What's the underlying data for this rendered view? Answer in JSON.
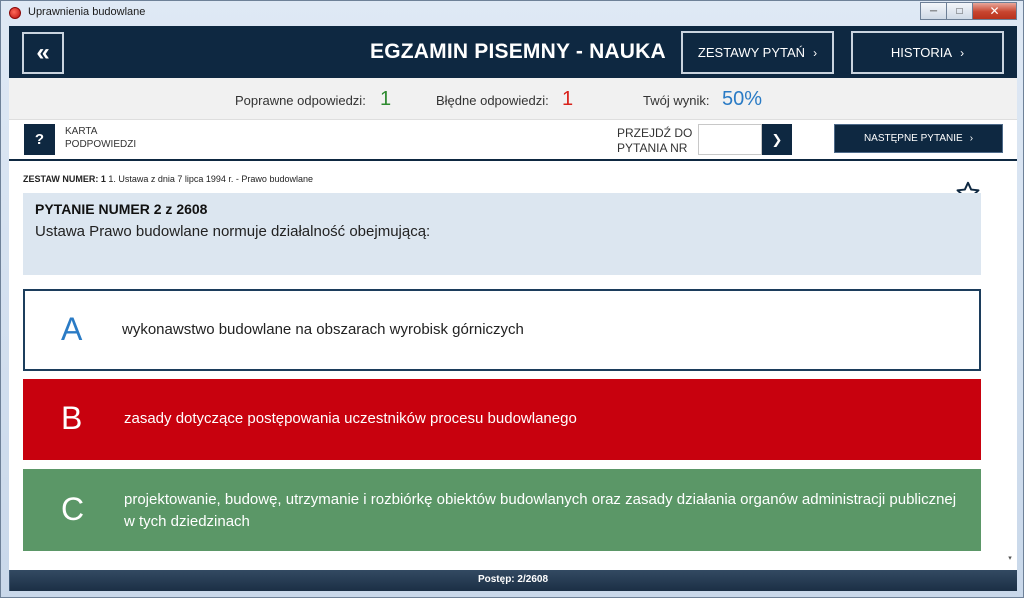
{
  "window": {
    "title": "Uprawnienia budowlane"
  },
  "header": {
    "title": "EGZAMIN PISEMNY - NAUKA",
    "sets_label": "ZESTAWY PYTAŃ",
    "history_label": "HISTORIA"
  },
  "stats": {
    "correct_label": "Poprawne odpowiedzi:",
    "correct_value": "1",
    "correct_color": "#2e8b30",
    "wrong_label": "Błędne odpowiedzi:",
    "wrong_value": "1",
    "wrong_color": "#d9221b",
    "score_label": "Twój wynik:",
    "score_value": "50%",
    "score_color": "#2a7bc5"
  },
  "toolbar": {
    "hint_button": "?",
    "hint_label": "KARTA PODPOWIEDZI",
    "goto_label": "PRZEJDŹ DO PYTANIA NR",
    "goto_value": "",
    "next_label": "NASTĘPNE PYTANIE"
  },
  "set": {
    "prefix": "ZESTAW NUMER: 1",
    "name": "1. Ustawa z dnia 7 lipca 1994 r. - Prawo budowlane"
  },
  "question": {
    "title": "PYTANIE NUMER 2 z 2608",
    "text": "Ustawa Prawo budowlane normuje działalność obejmującą:"
  },
  "answers": [
    {
      "letter": "A",
      "text": "wykonawstwo budowlane na obszarach wyrobisk górniczych",
      "state": "neutral"
    },
    {
      "letter": "B",
      "text": "zasady dotyczące postępowania uczestników procesu budowlanego",
      "state": "wrong"
    },
    {
      "letter": "C",
      "text": "projektowanie, budowę, utrzymanie i rozbiórkę obiektów budowlanych oraz zasady działania organów administracji publicznej w tych dziedzinach",
      "state": "correct"
    }
  ],
  "progress": {
    "label": "Postęp: 2/2608",
    "fraction": 0.000767
  },
  "colors": {
    "navy": "#0e2841",
    "wrong": "#c8010e",
    "correct": "#5b9767",
    "question_bg": "#dce6f0"
  },
  "icons": {
    "back": "double-chevron-left-icon",
    "chevron": "chevron-right-icon",
    "favorite": "star-outline-icon"
  }
}
